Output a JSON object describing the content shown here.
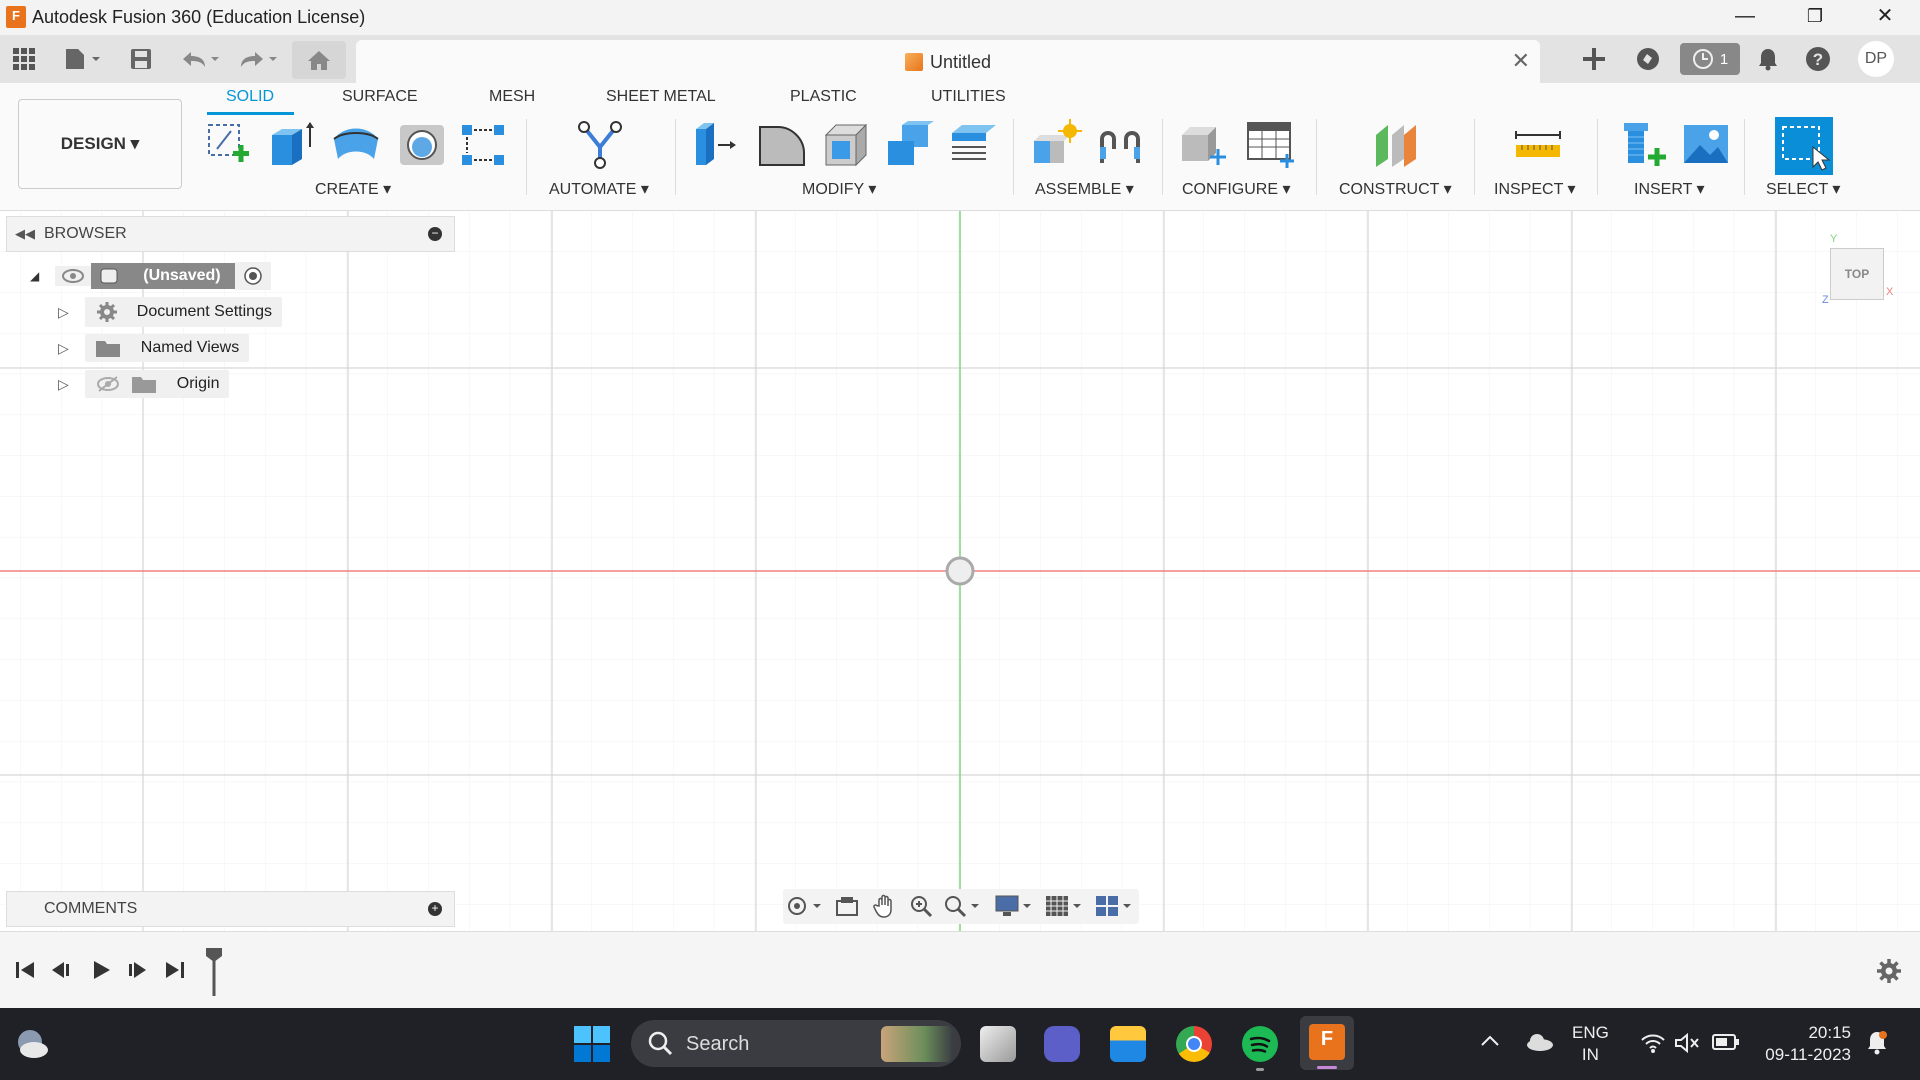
{
  "window": {
    "title": "Autodesk Fusion 360 (Education License)",
    "logo_text": "F",
    "minimize": "—",
    "restore": "❐",
    "close": "✕"
  },
  "quickbar": {
    "badge_count": "1",
    "user_initials": "DP"
  },
  "document": {
    "title": "Untitled"
  },
  "ribbon": {
    "workspace": "DESIGN ▾",
    "tabs": [
      "SOLID",
      "SURFACE",
      "MESH",
      "SHEET METAL",
      "PLASTIC",
      "UTILITIES"
    ],
    "groups": [
      "CREATE ▾",
      "AUTOMATE ▾",
      "MODIFY ▾",
      "ASSEMBLE ▾",
      "CONFIGURE ▾",
      "CONSTRUCT ▾",
      "INSPECT ▾",
      "INSERT ▾",
      "SELECT ▾"
    ]
  },
  "browser": {
    "title": "BROWSER",
    "root": "(Unsaved)",
    "items": [
      "Document Settings",
      "Named Views",
      "Origin"
    ]
  },
  "comments": {
    "title": "COMMENTS"
  },
  "viewcube": {
    "face": "TOP",
    "axis_y": "Y",
    "axis_x": "X",
    "axis_z": "Z"
  },
  "taskbar": {
    "search": "Search",
    "lang": "ENG",
    "region": "IN",
    "time": "20:15",
    "date": "09-11-2023"
  },
  "colors": {
    "accent": "#0696d7",
    "x_axis": "#f08080",
    "y_axis": "#7fd47f",
    "brand": "#e8731c"
  }
}
